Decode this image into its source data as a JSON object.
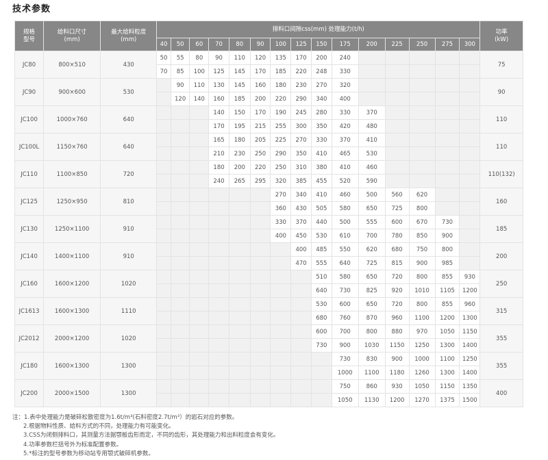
{
  "title": "技术参数",
  "headers": {
    "model": "规格\n型号",
    "feed_size": "给料口尺寸\n(mm)",
    "max_feed": "最大给料粒度\n(mm)",
    "capacity": "排料口间隙css(mm) 处理能力(t/h)",
    "power": "功率\n(kW)"
  },
  "css_columns": [
    "40",
    "50",
    "60",
    "70",
    "80",
    "90",
    "100",
    "125",
    "150",
    "175",
    "200",
    "225",
    "250",
    "275",
    "300"
  ],
  "rows": [
    {
      "model": "JC80",
      "feed": "800×510",
      "max": "430",
      "power": "75",
      "r1": [
        "50",
        "55",
        "80",
        "90",
        "110",
        "120",
        "135",
        "170",
        "200",
        "240",
        "",
        "",
        "",
        "",
        ""
      ],
      "r2": [
        "70",
        "85",
        "100",
        "125",
        "145",
        "170",
        "185",
        "220",
        "248",
        "330",
        "",
        "",
        "",
        "",
        ""
      ]
    },
    {
      "model": "JC90",
      "feed": "900×600",
      "max": "530",
      "power": "90",
      "r1": [
        "",
        "90",
        "110",
        "130",
        "145",
        "160",
        "180",
        "230",
        "270",
        "320",
        "",
        "",
        "",
        "",
        ""
      ],
      "r2": [
        "",
        "120",
        "140",
        "160",
        "185",
        "200",
        "220",
        "290",
        "340",
        "400",
        "",
        "",
        "",
        "",
        ""
      ]
    },
    {
      "model": "JC100",
      "feed": "1000×760",
      "max": "640",
      "power": "110",
      "r1": [
        "",
        "",
        "",
        "140",
        "150",
        "170",
        "190",
        "245",
        "280",
        "330",
        "370",
        "",
        "",
        "",
        ""
      ],
      "r2": [
        "",
        "",
        "",
        "170",
        "195",
        "215",
        "255",
        "300",
        "350",
        "420",
        "480",
        "",
        "",
        "",
        ""
      ]
    },
    {
      "model": "JC100L",
      "feed": "1150×760",
      "max": "640",
      "power": "110",
      "r1": [
        "",
        "",
        "",
        "165",
        "180",
        "205",
        "225",
        "270",
        "330",
        "370",
        "410",
        "",
        "",
        "",
        ""
      ],
      "r2": [
        "",
        "",
        "",
        "210",
        "230",
        "250",
        "290",
        "350",
        "410",
        "465",
        "530",
        "",
        "",
        "",
        ""
      ]
    },
    {
      "model": "JC110",
      "feed": "1100×850",
      "max": "720",
      "power": "110(132)",
      "r1": [
        "",
        "",
        "",
        "180",
        "200",
        "220",
        "250",
        "310",
        "380",
        "410",
        "460",
        "",
        "",
        "",
        ""
      ],
      "r2": [
        "",
        "",
        "",
        "240",
        "265",
        "295",
        "320",
        "385",
        "455",
        "520",
        "590",
        "",
        "",
        "",
        ""
      ]
    },
    {
      "model": "JC125",
      "feed": "1250×950",
      "max": "810",
      "power": "160",
      "r1": [
        "",
        "",
        "",
        "",
        "",
        "",
        "270",
        "340",
        "410",
        "460",
        "500",
        "560",
        "620",
        "",
        ""
      ],
      "r2": [
        "",
        "",
        "",
        "",
        "",
        "",
        "360",
        "430",
        "505",
        "580",
        "650",
        "725",
        "800",
        "",
        ""
      ]
    },
    {
      "model": "JC130",
      "feed": "1250×1100",
      "max": "910",
      "power": "185",
      "r1": [
        "",
        "",
        "",
        "",
        "",
        "",
        "330",
        "370",
        "440",
        "500",
        "555",
        "600",
        "670",
        "730",
        ""
      ],
      "r2": [
        "",
        "",
        "",
        "",
        "",
        "",
        "400",
        "450",
        "530",
        "610",
        "700",
        "780",
        "850",
        "900",
        ""
      ]
    },
    {
      "model": "JC140",
      "feed": "1400×1100",
      "max": "910",
      "power": "200",
      "r1": [
        "",
        "",
        "",
        "",
        "",
        "",
        "",
        "400",
        "485",
        "550",
        "620",
        "680",
        "750",
        "800",
        ""
      ],
      "r2": [
        "",
        "",
        "",
        "",
        "",
        "",
        "",
        "470",
        "555",
        "640",
        "725",
        "815",
        "900",
        "985",
        ""
      ]
    },
    {
      "model": "JC160",
      "feed": "1600×1200",
      "max": "1020",
      "power": "250",
      "r1": [
        "",
        "",
        "",
        "",
        "",
        "",
        "",
        "",
        "510",
        "580",
        "650",
        "720",
        "800",
        "855",
        "930"
      ],
      "r2": [
        "",
        "",
        "",
        "",
        "",
        "",
        "",
        "",
        "640",
        "730",
        "825",
        "920",
        "1010",
        "1105",
        "1200"
      ]
    },
    {
      "model": "JC1613",
      "feed": "1600×1300",
      "max": "1110",
      "power": "315",
      "r1": [
        "",
        "",
        "",
        "",
        "",
        "",
        "",
        "",
        "530",
        "600",
        "650",
        "720",
        "800",
        "855",
        "960"
      ],
      "r2": [
        "",
        "",
        "",
        "",
        "",
        "",
        "",
        "",
        "680",
        "760",
        "870",
        "960",
        "1100",
        "1200",
        "1300"
      ]
    },
    {
      "model": "JC2012",
      "feed": "2000×1200",
      "max": "1020",
      "power": "355",
      "r1": [
        "",
        "",
        "",
        "",
        "",
        "",
        "",
        "",
        "600",
        "700",
        "800",
        "880",
        "970",
        "1050",
        "1150"
      ],
      "r2": [
        "",
        "",
        "",
        "",
        "",
        "",
        "",
        "",
        "730",
        "900",
        "1030",
        "1150",
        "1250",
        "1300",
        "1400"
      ]
    },
    {
      "model": "JC180",
      "feed": "1600×1300",
      "max": "1300",
      "power": "355",
      "r1": [
        "",
        "",
        "",
        "",
        "",
        "",
        "",
        "",
        "",
        "730",
        "830",
        "900",
        "1000",
        "1100",
        "1250"
      ],
      "r2": [
        "",
        "",
        "",
        "",
        "",
        "",
        "",
        "",
        "",
        "1000",
        "1100",
        "1180",
        "1260",
        "1300",
        "1400"
      ]
    },
    {
      "model": "JC200",
      "feed": "2000×1500",
      "max": "1300",
      "power": "400",
      "r1": [
        "",
        "",
        "",
        "",
        "",
        "",
        "",
        "",
        "",
        "750",
        "860",
        "930",
        "1050",
        "1150",
        "1350"
      ],
      "r2": [
        "",
        "",
        "",
        "",
        "",
        "",
        "",
        "",
        "",
        "1050",
        "1130",
        "1200",
        "1270",
        "1375",
        "1500"
      ]
    }
  ],
  "notes": [
    "注：1.表中处理能力是破碎松散密度为1.6t/m³(石料密度2.7t/m³）的岩石对应的参数。",
    "2.根据物料性质、给料方式的不同，处理能力有可能变化。",
    "3.CSS为闭侧排料口，其测量方法据颚板齿形而定，不同的齿形，其处理能力和出料粒度会有变化。",
    "4.功率参数栏括号外为标准配置参数。",
    "5.*标注的型号参数为移动站专用颚式破碎机参数。"
  ],
  "colors": {
    "header_bg": "#878787",
    "header_text": "#ffffff",
    "empty_cell": "#f1f1f1",
    "border": "#e3e3e3"
  }
}
